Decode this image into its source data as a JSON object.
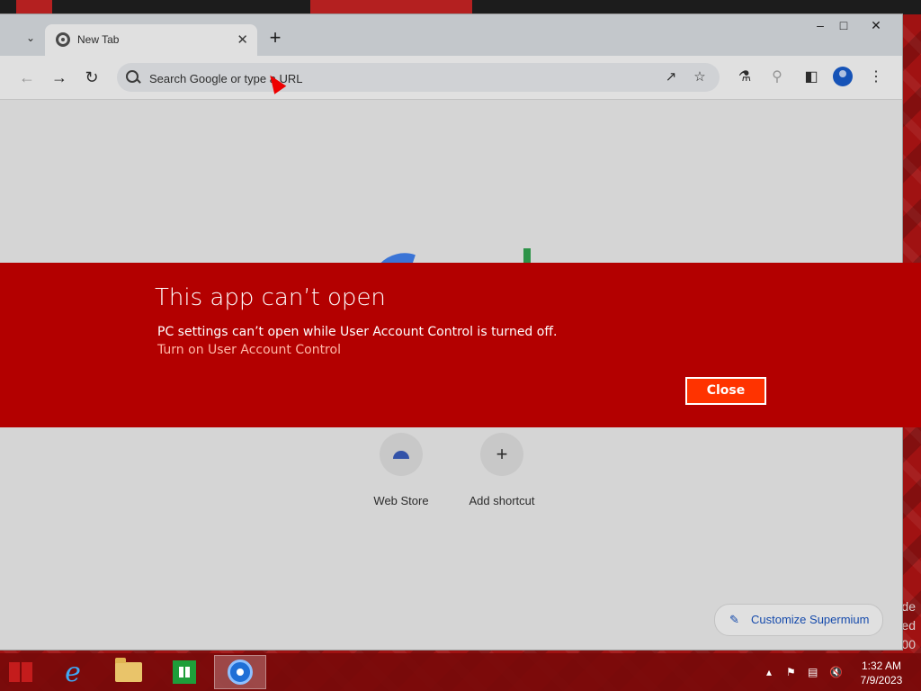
{
  "browser": {
    "tab_title": "New Tab",
    "omnibox_placeholder": "Search Google or type a URL"
  },
  "shortcuts": [
    {
      "label": "Web Store"
    },
    {
      "label": "Add shortcut"
    }
  ],
  "customize_label": "Customize Supermium",
  "dialog": {
    "title": "This app can’t open",
    "message": "PC settings can’t open while User Account Control is turned off.",
    "link": "Turn on User Account Control",
    "close_label": "Close"
  },
  "taskbar": {
    "time": "1:32 AM",
    "date": "7/9/2023"
  },
  "desktop_partial_text": [
    "de",
    "ed",
    "00"
  ],
  "colors": {
    "banner": "#b30000",
    "close_button": "#ff3300"
  }
}
